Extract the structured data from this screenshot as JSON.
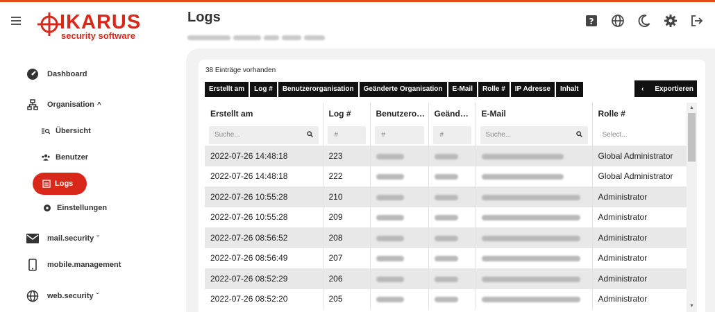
{
  "brand": {
    "name": "IKARUS",
    "tagline": "security software",
    "accent": "#d9281a"
  },
  "header": {
    "title": "Logs",
    "icons": [
      "help-icon",
      "globe-icon",
      "moon-icon",
      "gear-icon",
      "logout-icon"
    ]
  },
  "sidebar": {
    "items": [
      {
        "label": "Dashboard",
        "icon": "dashboard-icon"
      },
      {
        "label": "Organisation",
        "icon": "organisation-icon",
        "caret": "^"
      },
      {
        "label": "Übersicht",
        "icon": "overview-icon"
      },
      {
        "label": "Benutzer",
        "icon": "users-icon"
      },
      {
        "label": "Logs",
        "icon": "logs-icon",
        "active": true
      },
      {
        "label": "Einstellungen",
        "icon": "settings-icon"
      },
      {
        "label": "mail.security",
        "icon": "mail-icon",
        "caret": "ˇ"
      },
      {
        "label": "mobile.management",
        "icon": "mobile-icon"
      },
      {
        "label": "web.security",
        "icon": "web-icon",
        "caret": "ˇ"
      }
    ]
  },
  "content": {
    "count_text": "38 Einträge vorhanden",
    "column_chips": [
      "Erstellt am",
      "Log #",
      "Benutzerorganisation",
      "Geänderte Organisation",
      "E-Mail",
      "Rolle #",
      "IP Adresse",
      "Inhalt"
    ],
    "export_label": "Exportieren",
    "export_arrow": "‹",
    "table": {
      "headers": [
        "Erstellt am",
        "Log #",
        "Benutzero…",
        "Geänd…",
        "E-Mail",
        "Rolle #"
      ],
      "filters": {
        "created_placeholder": "Suche...",
        "log_placeholder": "#",
        "org_placeholder": "#",
        "changed_placeholder": "#",
        "email_placeholder": "Suche...",
        "role_placeholder": "Select..."
      },
      "rows": [
        {
          "date": "2022-07-26 14:48:18",
          "log": "223",
          "role": "Global Administrator"
        },
        {
          "date": "2022-07-26 14:48:18",
          "log": "222",
          "role": "Global Administrator"
        },
        {
          "date": "2022-07-26 10:55:28",
          "log": "210",
          "role": "Administrator"
        },
        {
          "date": "2022-07-26 10:55:28",
          "log": "209",
          "role": "Administrator"
        },
        {
          "date": "2022-07-26 08:56:52",
          "log": "208",
          "role": "Administrator"
        },
        {
          "date": "2022-07-26 08:56:49",
          "log": "207",
          "role": "Administrator"
        },
        {
          "date": "2022-07-26 08:52:29",
          "log": "206",
          "role": "Administrator"
        },
        {
          "date": "2022-07-26 08:52:20",
          "log": "205",
          "role": "Administrator"
        }
      ]
    }
  }
}
